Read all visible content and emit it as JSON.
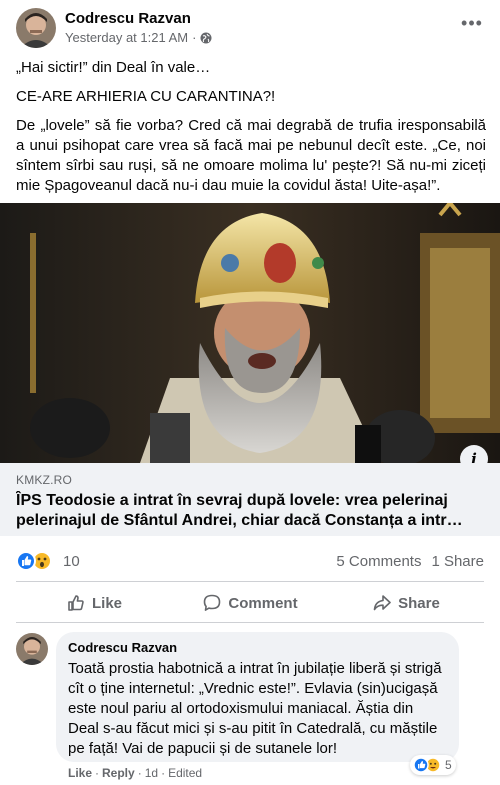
{
  "post": {
    "author": "Codrescu Razvan",
    "timestamp": "Yesterday at 1:21 AM",
    "separator": "·",
    "privacy_icon": "globe-icon",
    "more_label": "•••",
    "text": {
      "line1": "„Hai sictir!” din Deal în vale…",
      "line2": "CE-ARE ARHIERIA CU CARANTINA?!",
      "line3": "De „lovele” să fie vorba? Cred că mai degrabă de trufia iresponsabilă a unui psihopat care vrea să facă mai pe nebunul decît este. „Ce, noi sîntem sîrbi sau ruși, să ne omoare molima lu' pește?! Să nu-mi ziceți mie Șpagoveanul dacă nu-i dau muie la covidul ăsta! Uite-așa!”."
    }
  },
  "link_preview": {
    "info_label": "i",
    "domain": "KMKZ.RO",
    "title_line1": "ÎPS Teodosie a intrat în sevraj după lovele: vrea pelerinaj",
    "title_line2": "pelerinajul de Sfântul Andrei, chiar dacă Constanța a intr…"
  },
  "stats": {
    "reaction_icons": [
      "like-icon",
      "wow-icon"
    ],
    "reaction_count": "10",
    "comments": "5 Comments",
    "shares": "1 Share"
  },
  "actions": {
    "like": "Like",
    "comment": "Comment",
    "share": "Share"
  },
  "comment": {
    "author": "Codrescu Razvan",
    "text": "Toată prostia habotnică a intrat în jubilație liberă și strigă cît o ține internetul: „Vrednic este!”. Evlavia (sin)ucigașă este noul pariu al ortodoxismului maniacal. Ăștia din Deal s-au făcut mici și s-au pitit în Catedrală, cu măștile pe față! Vai de papucii și de sutanele lor!",
    "reaction_count": "5",
    "like": "Like",
    "reply": "Reply",
    "age": "1d",
    "edited": "Edited",
    "dot": "·"
  },
  "colors": {
    "facebook_blue": "#1877f2",
    "secondary_text": "#65676b",
    "preview_bg": "#f0f2f5",
    "wow_yellow": "#f7b928"
  }
}
